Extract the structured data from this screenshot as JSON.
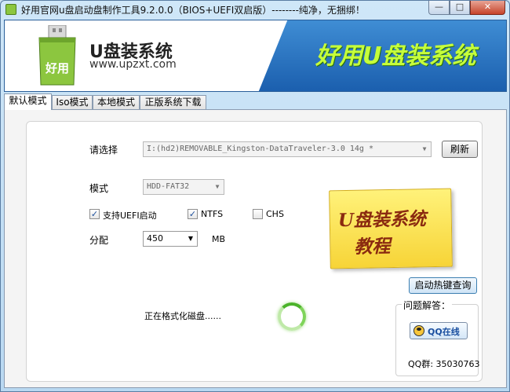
{
  "window": {
    "title": "好用官网u盘启动盘制作工具9.2.0.0（BIOS+UEFI双启版）--------纯净，无捆绑！",
    "minimize": "—",
    "maximize": "□",
    "close": "✕"
  },
  "banner": {
    "logo_text": "好用",
    "brand": "U盘装系统",
    "url": "www.upzxt.com",
    "slogan": "好用U盘装系统"
  },
  "tabs": [
    {
      "label": "默认模式"
    },
    {
      "label": "Iso模式"
    },
    {
      "label": "本地模式"
    },
    {
      "label": "正版系统下载"
    }
  ],
  "form": {
    "select_label": "请选择",
    "device": "I:(hd2)REMOVABLE_Kingston-DataTraveler-3.0 14g *",
    "refresh": "刷新",
    "mode_label": "模式",
    "mode_value": "HDD-FAT32",
    "uefi_label": "支持UEFI启动",
    "uefi_checked": true,
    "ntfs_label": "NTFS",
    "ntfs_checked": true,
    "chs_label": "CHS",
    "chs_checked": false,
    "partition_label": "分配",
    "partition_value": "450",
    "partition_unit": "MB"
  },
  "tutorial": {
    "title": "U盘装系统",
    "subtitle": "教程"
  },
  "hotkey_button": "启动热键查询",
  "status_text": "正在格式化磁盘......",
  "qa": {
    "title": "问题解答：",
    "qq_button": "QQ在线",
    "qq_group": "QQ群: 35030763"
  },
  "icons": {
    "app": "usb-drive-icon",
    "logo": "usb-drive-logo-icon",
    "qq": "qq-penguin-icon",
    "spinner": "loading-spinner-icon"
  },
  "colors": {
    "banner_blue": "#1b5fae",
    "slogan_green": "#c6ff3a",
    "note_yellow": "#f7d437",
    "spinner_green": "#4bb32a"
  }
}
